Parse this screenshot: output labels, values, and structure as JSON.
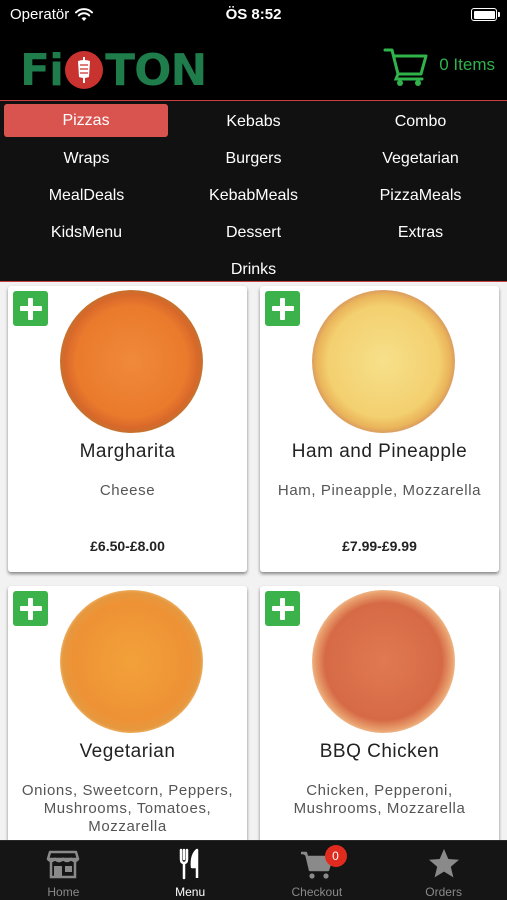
{
  "status_bar": {
    "carrier": "Operatör",
    "time": "ÖS 8:52"
  },
  "header": {
    "logo_text_left": "Fi",
    "logo_text_right": "TON",
    "cart_label": "0 Items"
  },
  "categories": [
    {
      "label": "Pizzas",
      "active": true
    },
    {
      "label": "Kebabs",
      "active": false
    },
    {
      "label": "Combo",
      "active": false
    },
    {
      "label": "Wraps",
      "active": false
    },
    {
      "label": "Burgers",
      "active": false
    },
    {
      "label": "Vegetarian",
      "active": false
    },
    {
      "label": "MealDeals",
      "active": false
    },
    {
      "label": "KebabMeals",
      "active": false
    },
    {
      "label": "PizzaMeals",
      "active": false
    },
    {
      "label": "KidsMenu",
      "active": false
    },
    {
      "label": "Dessert",
      "active": false
    },
    {
      "label": "Extras",
      "active": false
    },
    {
      "label": "Drinks",
      "active": false
    }
  ],
  "products": [
    {
      "name": "Margharita",
      "description": "Cheese",
      "price": "£6.50-£8.00"
    },
    {
      "name": "Ham and Pineapple",
      "description": "Ham, Pineapple, Mozzarella",
      "price": "£7.99-£9.99"
    },
    {
      "name": "Vegetarian",
      "description": "Onions, Sweetcorn, Peppers, Mushrooms, Tomatoes, Mozzarella",
      "price": ""
    },
    {
      "name": "BBQ Chicken",
      "description": "Chicken, Pepperoni, Mushrooms, Mozzarella",
      "price": ""
    }
  ],
  "tabbar": {
    "items": [
      {
        "label": "Home",
        "icon": "store-icon"
      },
      {
        "label": "Menu",
        "icon": "fork-knife-icon"
      },
      {
        "label": "Checkout",
        "icon": "cart-icon"
      },
      {
        "label": "Orders",
        "icon": "star-icon"
      }
    ],
    "checkout_badge": "0"
  },
  "colors": {
    "accent_red": "#d9534f",
    "brand_green": "#2fb34a",
    "add_button": "#3cb34a"
  }
}
